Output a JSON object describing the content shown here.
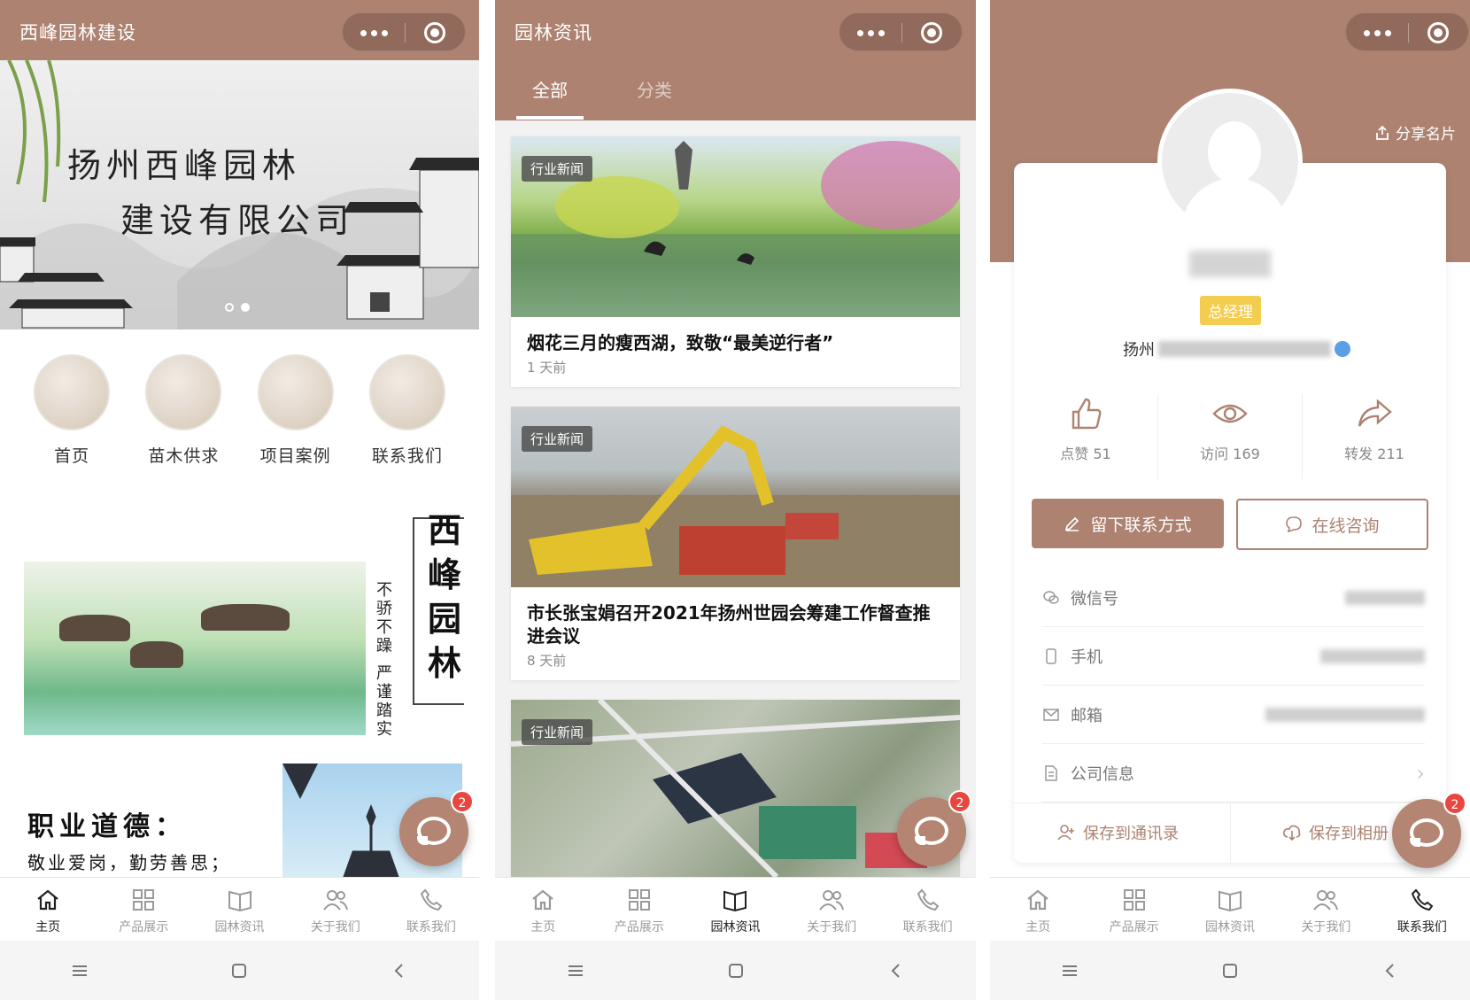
{
  "screen1": {
    "title": "西峰园林建设",
    "banner": {
      "line1": "扬州西峰园林",
      "line2": "建设有限公司"
    },
    "categories": [
      "首页",
      "苗木供求",
      "项目案例",
      "联系我们"
    ],
    "brand_vertical": [
      "西",
      "峰",
      "园",
      "林"
    ],
    "slogan_vertical": [
      "不",
      "骄",
      "不",
      "躁",
      "严",
      "谨",
      "踏",
      "实"
    ],
    "ethics_title": "职业道德：",
    "ethics_text": "敬业爱岗，勤劳善思；",
    "fab_badge": "2"
  },
  "screen2": {
    "title": "园林资讯",
    "tabs": [
      "全部",
      "分类"
    ],
    "articles": [
      {
        "tag": "行业新闻",
        "title": "烟花三月的瘦西湖，致敬“最美逆行者”",
        "time": "1 天前"
      },
      {
        "tag": "行业新闻",
        "title": "市长张宝娟召开2021年扬州世园会筹建工作督查推进会议",
        "time": "8 天前"
      },
      {
        "tag": "行业新闻"
      }
    ],
    "fab_badge": "2"
  },
  "screen3": {
    "share": "分享名片",
    "role": "总经理",
    "company_prefix": "扬州",
    "stats": [
      {
        "label": "点赞 51"
      },
      {
        "label": "访问 169"
      },
      {
        "label": "转发 211"
      }
    ],
    "btn_contact": "留下联系方式",
    "btn_consult": "在线咨询",
    "rows": [
      "微信号",
      "手机",
      "邮箱",
      "公司信息"
    ],
    "save_contacts": "保存到通讯录",
    "save_album": "保存到相册",
    "fab_badge": "2"
  },
  "tabbar": [
    "主页",
    "产品展示",
    "园林资讯",
    "关于我们",
    "联系我们"
  ],
  "colors": {
    "brand": "#ad8271",
    "role_badge": "#f4cc4f",
    "fab_badge": "#e8473f"
  }
}
